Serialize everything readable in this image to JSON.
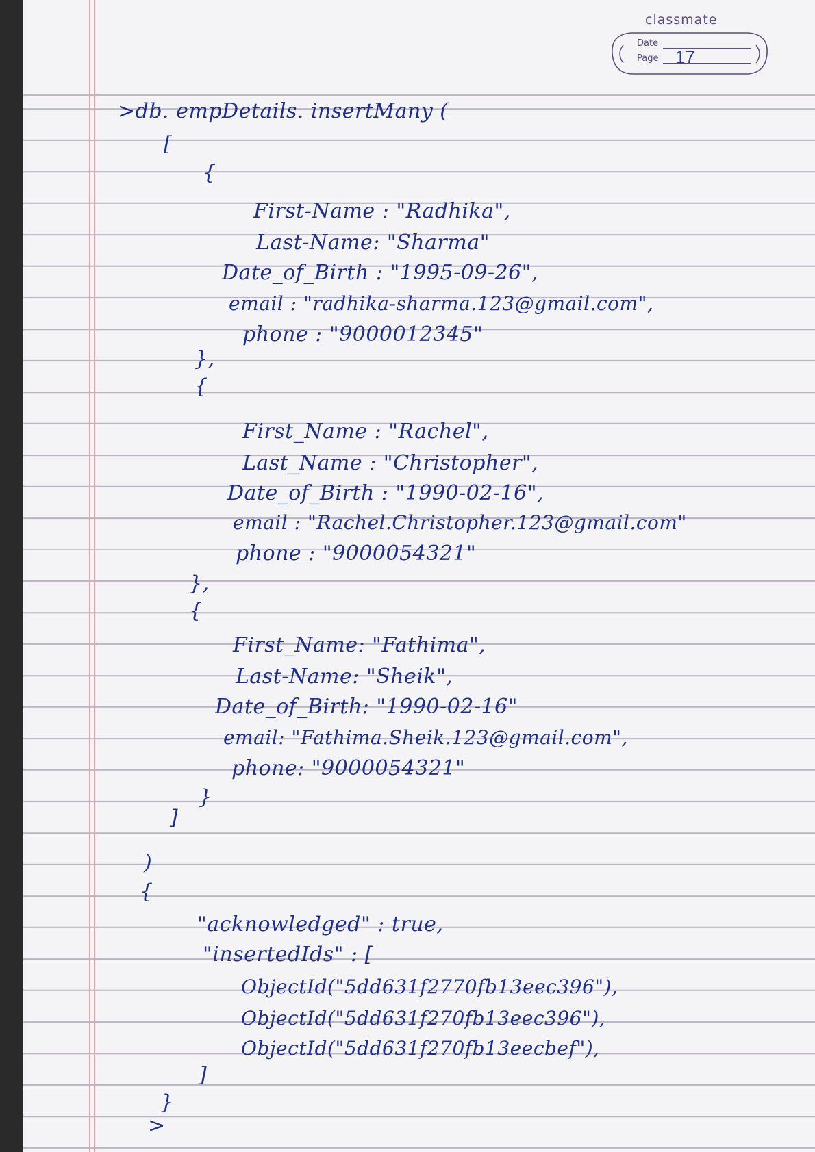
{
  "header": {
    "brand": "classmate",
    "date_label": "Date",
    "page_label": "Page",
    "page_number": "17"
  },
  "lines": [
    ">db. empDetails. insertMany (",
    "[",
    "{",
    "First-Name : \"Radhika\",",
    "Last-Name: \"Sharma\"",
    "Date_of_Birth : \"1995-09-26\",",
    "email : \"radhika-sharma.123@gmail.com\",",
    "phone : \"9000012345\"",
    "},",
    "{",
    "First_Name : \"Rachel\",",
    "Last_Name : \"Christopher\",",
    "Date_of_Birth : \"1990-02-16\",",
    "email : \"Rachel.Christopher.123@gmail.com\"",
    "phone : \"9000054321\"",
    "},",
    "{",
    "First_Name: \"Fathima\",",
    "Last-Name: \"Sheik\",",
    "Date_of_Birth: \"1990-02-16\"",
    "email: \"Fathima.Sheik.123@gmail.com\",",
    "phone: \"9000054321\"",
    "}",
    "]",
    ")",
    "{",
    "\"acknowledged\" : true,",
    "\"insertedIds\" : [",
    "ObjectId(\"5dd631f2770fb13eec396\"),",
    "ObjectId(\"5dd631f270fb13eec396\"),",
    "ObjectId(\"5dd631f270fb13eecbef\"),",
    "]",
    "}",
    ">"
  ]
}
